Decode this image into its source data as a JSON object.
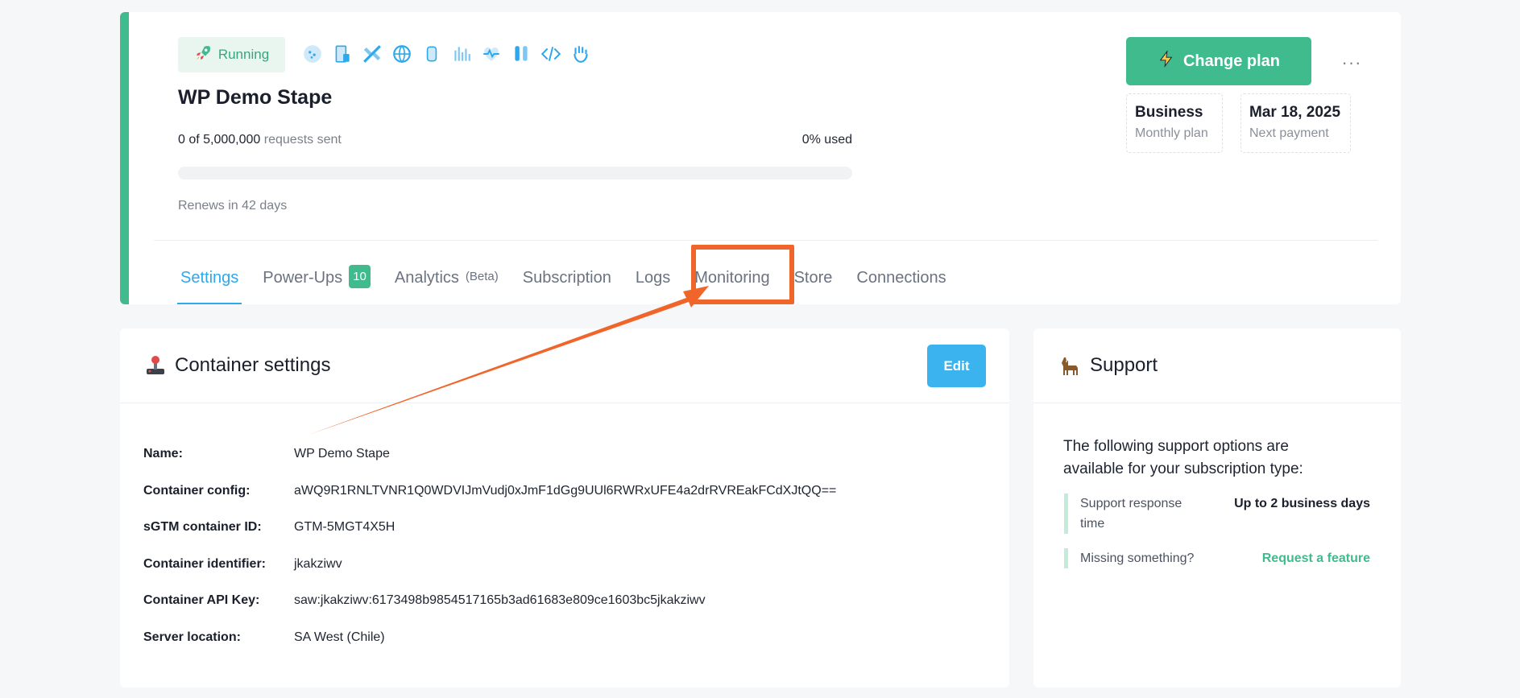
{
  "container": {
    "status": "Running",
    "title": "WP Demo Stape",
    "requests_used": "0 of 5,000,000",
    "requests_suffix": "requests sent",
    "usage_percent": "0% used",
    "usage_fraction": 0,
    "renews": "Renews in 42 days"
  },
  "powerup_icons": [
    "globe-dots-icon",
    "building-icon",
    "satellite-icon",
    "globe-icon",
    "cylinder-icon",
    "signal-bars-icon",
    "heart-pulse-icon",
    "test-tubes-icon",
    "code-icon",
    "hand-icon"
  ],
  "actions": {
    "change_plan": "Change plan",
    "more": "···"
  },
  "plan": {
    "name": "Business",
    "name_sub": "Monthly plan",
    "next_date": "Mar 18, 2025",
    "next_sub": "Next payment"
  },
  "tabs": [
    {
      "label": "Settings"
    },
    {
      "label": "Power-Ups",
      "badge": "10"
    },
    {
      "label": "Analytics",
      "suffix": "(Beta)"
    },
    {
      "label": "Subscription"
    },
    {
      "label": "Logs"
    },
    {
      "label": "Monitoring"
    },
    {
      "label": "Store"
    },
    {
      "label": "Connections"
    }
  ],
  "settings": {
    "title": "Container settings",
    "edit": "Edit",
    "fields": [
      {
        "label": "Name:",
        "value": "WP Demo Stape"
      },
      {
        "label": "Container config:",
        "value": "aWQ9R1RNLTVNR1Q0WDVIJmVudj0xJmF1dGg9UUl6RWRxUFE4a2drRVREakFCdXJtQQ=="
      },
      {
        "label": "sGTM container ID:",
        "value": "GTM-5MGT4X5H"
      },
      {
        "label": "Container identifier:",
        "value": "jkakziwv"
      },
      {
        "label": "Container API Key:",
        "value": "saw:jkakziwv:6173498b9854517165b3ad61683e809ce1603bc5jkakziwv"
      },
      {
        "label": "Server location:",
        "value": "SA West (Chile)"
      }
    ]
  },
  "support": {
    "title": "Support",
    "description": "The following support options are available for your subscription type:",
    "items": [
      {
        "key": "Support response time",
        "value": "Up to 2 business days"
      },
      {
        "key": "Missing something?",
        "value": "Request a feature"
      }
    ]
  },
  "colors": {
    "accent_green": "#3fbb8e",
    "accent_blue": "#2ea8ea",
    "annotation_orange": "#f0662a"
  }
}
